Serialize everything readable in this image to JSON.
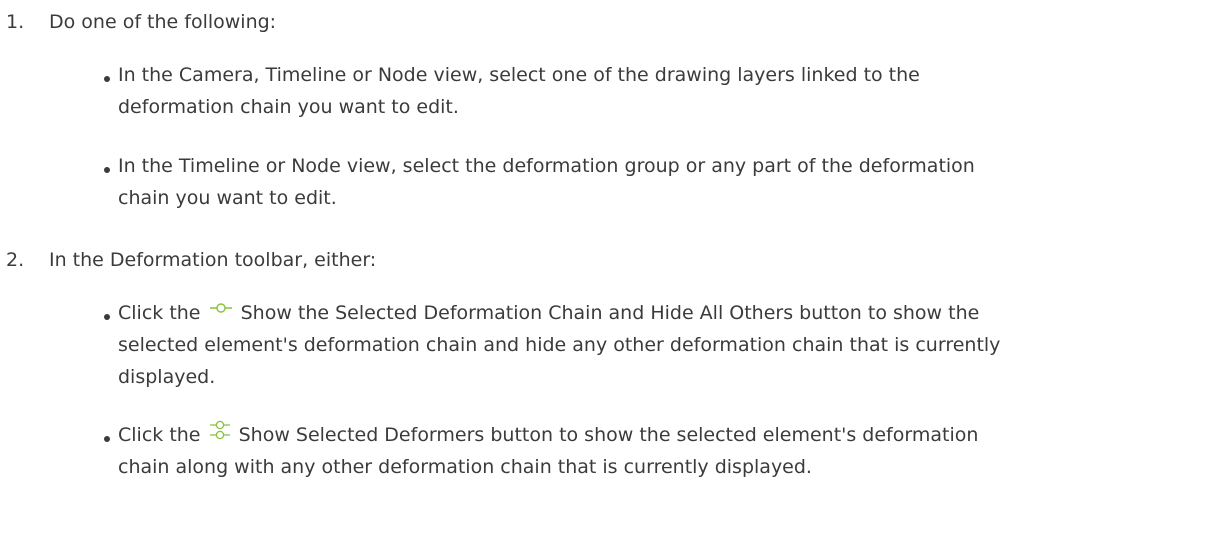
{
  "steps": [
    {
      "number": "1.",
      "text": "Do one of the following:",
      "bullets": [
        {
          "lines": [
            "In the Camera, Timeline or Node view, select one of the drawing layers linked to the",
            "deformation chain you want to edit."
          ]
        },
        {
          "lines": [
            "In the Timeline or Node view, select the deformation group or any part of the deformation",
            "chain you want to edit."
          ]
        }
      ]
    },
    {
      "number": "2.",
      "text": "In the Deformation toolbar, either:",
      "bullets": [
        {
          "prefix": "Click the",
          "icon": "show-selected-deformation-chain-icon",
          "lines": [
            "Show the Selected Deformation Chain and Hide All Others button to show the",
            "selected element's deformation chain and hide any other deformation chain that is currently",
            "displayed."
          ]
        },
        {
          "prefix": "Click the",
          "icon": "show-selected-deformers-icon",
          "lines": [
            "Show Selected Deformers button to show the selected element's deformation",
            "chain along with any other deformation chain that is currently displayed."
          ]
        }
      ]
    }
  ],
  "colors": {
    "text": "#3b3b3b",
    "icon": "#88c23a"
  }
}
